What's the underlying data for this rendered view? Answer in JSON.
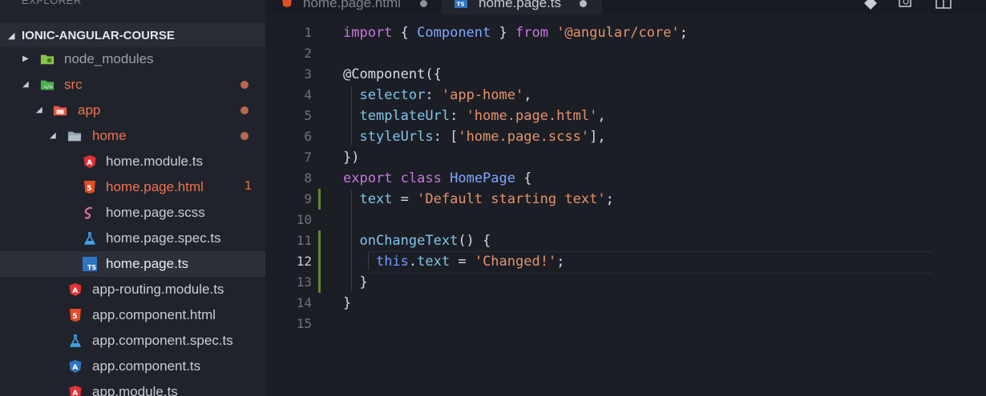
{
  "sidebar": {
    "header": "EXPLORER",
    "project": "IONIC-ANGULAR-COURSE",
    "items": [
      {
        "label": "node_modules",
        "icon": "folder-node-icon"
      },
      {
        "label": "src",
        "icon": "folder-src-icon"
      },
      {
        "label": "app",
        "icon": "folder-app-icon"
      },
      {
        "label": "home",
        "icon": "folder-icon"
      },
      {
        "label": "home.module.ts",
        "icon": "angular-icon"
      },
      {
        "label": "home.page.html",
        "icon": "html5-icon",
        "badge": "1"
      },
      {
        "label": "home.page.scss",
        "icon": "sass-icon"
      },
      {
        "label": "home.page.spec.ts",
        "icon": "flask-test-icon"
      },
      {
        "label": "home.page.ts",
        "icon": "typescript-icon"
      },
      {
        "label": "app-routing.module.ts",
        "icon": "angular-icon"
      },
      {
        "label": "app.component.html",
        "icon": "html5-icon"
      },
      {
        "label": "app.component.spec.ts",
        "icon": "flask-test-icon"
      },
      {
        "label": "app.component.ts",
        "icon": "angular-blue-icon"
      },
      {
        "label": "app.module.ts",
        "icon": "angular-icon"
      }
    ]
  },
  "tabs": [
    {
      "label": "home.page.html",
      "icon": "html5-icon"
    },
    {
      "label": "home.page.ts",
      "icon": "typescript-icon"
    }
  ],
  "editor": {
    "line_numbers": [
      "1",
      "2",
      "3",
      "4",
      "5",
      "6",
      "7",
      "8",
      "9",
      "10",
      "11",
      "12",
      "13",
      "14",
      "15"
    ],
    "current_line": "12",
    "lines": [
      [
        [
          "kw",
          "import"
        ],
        [
          "punc",
          " { "
        ],
        [
          "cls",
          "Component"
        ],
        [
          "punc",
          " } "
        ],
        [
          "kw",
          "from"
        ],
        [
          "punc",
          " "
        ],
        [
          "str",
          "'@angular/core'"
        ],
        [
          "punc",
          ";"
        ]
      ],
      [],
      [
        [
          "dec",
          "@Component"
        ],
        [
          "punc",
          "({"
        ]
      ],
      [
        [
          "punc",
          "  "
        ],
        [
          "prop",
          "selector"
        ],
        [
          "punc",
          ": "
        ],
        [
          "str",
          "'app-home'"
        ],
        [
          "punc",
          ","
        ]
      ],
      [
        [
          "punc",
          "  "
        ],
        [
          "prop",
          "templateUrl"
        ],
        [
          "punc",
          ": "
        ],
        [
          "str",
          "'home.page.html'"
        ],
        [
          "punc",
          ","
        ]
      ],
      [
        [
          "punc",
          "  "
        ],
        [
          "prop",
          "styleUrls"
        ],
        [
          "punc",
          ": ["
        ],
        [
          "str",
          "'home.page.scss'"
        ],
        [
          "punc",
          "],"
        ]
      ],
      [
        [
          "punc",
          "})"
        ]
      ],
      [
        [
          "kw",
          "export"
        ],
        [
          "punc",
          " "
        ],
        [
          "kw",
          "class"
        ],
        [
          "punc",
          " "
        ],
        [
          "cls",
          "HomePage"
        ],
        [
          "punc",
          " {"
        ]
      ],
      [
        [
          "punc",
          "  "
        ],
        [
          "prop",
          "text"
        ],
        [
          "punc",
          " = "
        ],
        [
          "str",
          "'Default starting text'"
        ],
        [
          "punc",
          ";"
        ]
      ],
      [],
      [
        [
          "punc",
          "  "
        ],
        [
          "fn",
          "onChangeText"
        ],
        [
          "punc",
          "() {"
        ]
      ],
      [
        [
          "punc",
          "    "
        ],
        [
          "this",
          "this"
        ],
        [
          "punc",
          "."
        ],
        [
          "prop",
          "text"
        ],
        [
          "punc",
          " = "
        ],
        [
          "str",
          "'Changed!'"
        ],
        [
          "punc",
          ";"
        ]
      ],
      [
        [
          "punc",
          "  }"
        ]
      ],
      [
        [
          "punc",
          "}"
        ]
      ],
      []
    ]
  },
  "colors": {
    "modified": "#f0734f",
    "git_added_bar": "#5f8a3a",
    "keyword": "#c678dd",
    "string": "#e5936b",
    "class": "#7ea7ff"
  }
}
